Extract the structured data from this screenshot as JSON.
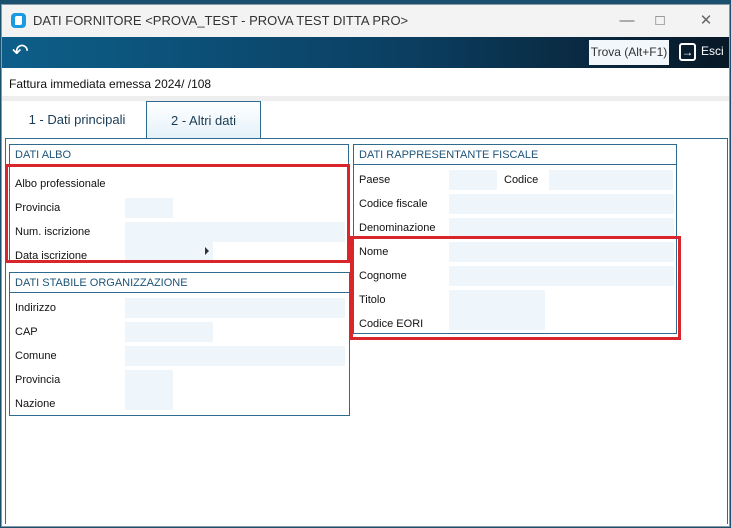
{
  "window": {
    "title": "DATI FORNITORE <PROVA_TEST - PROVA TEST DITTA PRO>"
  },
  "toolbar": {
    "trova": "Trova (Alt+F1)",
    "esci": "Esci"
  },
  "info": "Fattura immediata emessa 2024/ /108",
  "tabs": [
    {
      "label": "1 - Dati principali"
    },
    {
      "label": "2 - Altri dati"
    }
  ],
  "albo": {
    "title": "DATI ALBO",
    "albo": "Albo professionale",
    "provincia": "Provincia",
    "num": "Num. iscrizione",
    "data": "Data iscrizione"
  },
  "stabile": {
    "title": "DATI STABILE ORGANIZZAZIONE",
    "indirizzo": "Indirizzo",
    "cap": "CAP",
    "comune": "Comune",
    "provincia": "Provincia",
    "nazione": "Nazione"
  },
  "rappr": {
    "title": "DATI RAPPRESENTANTE FISCALE",
    "paese": "Paese",
    "codice": "Codice",
    "cf": "Codice fiscale",
    "denominazione": "Denominazione",
    "nome": "Nome",
    "cognome": "Cognome",
    "titolo": "Titolo",
    "eori": "Codice EORI"
  }
}
